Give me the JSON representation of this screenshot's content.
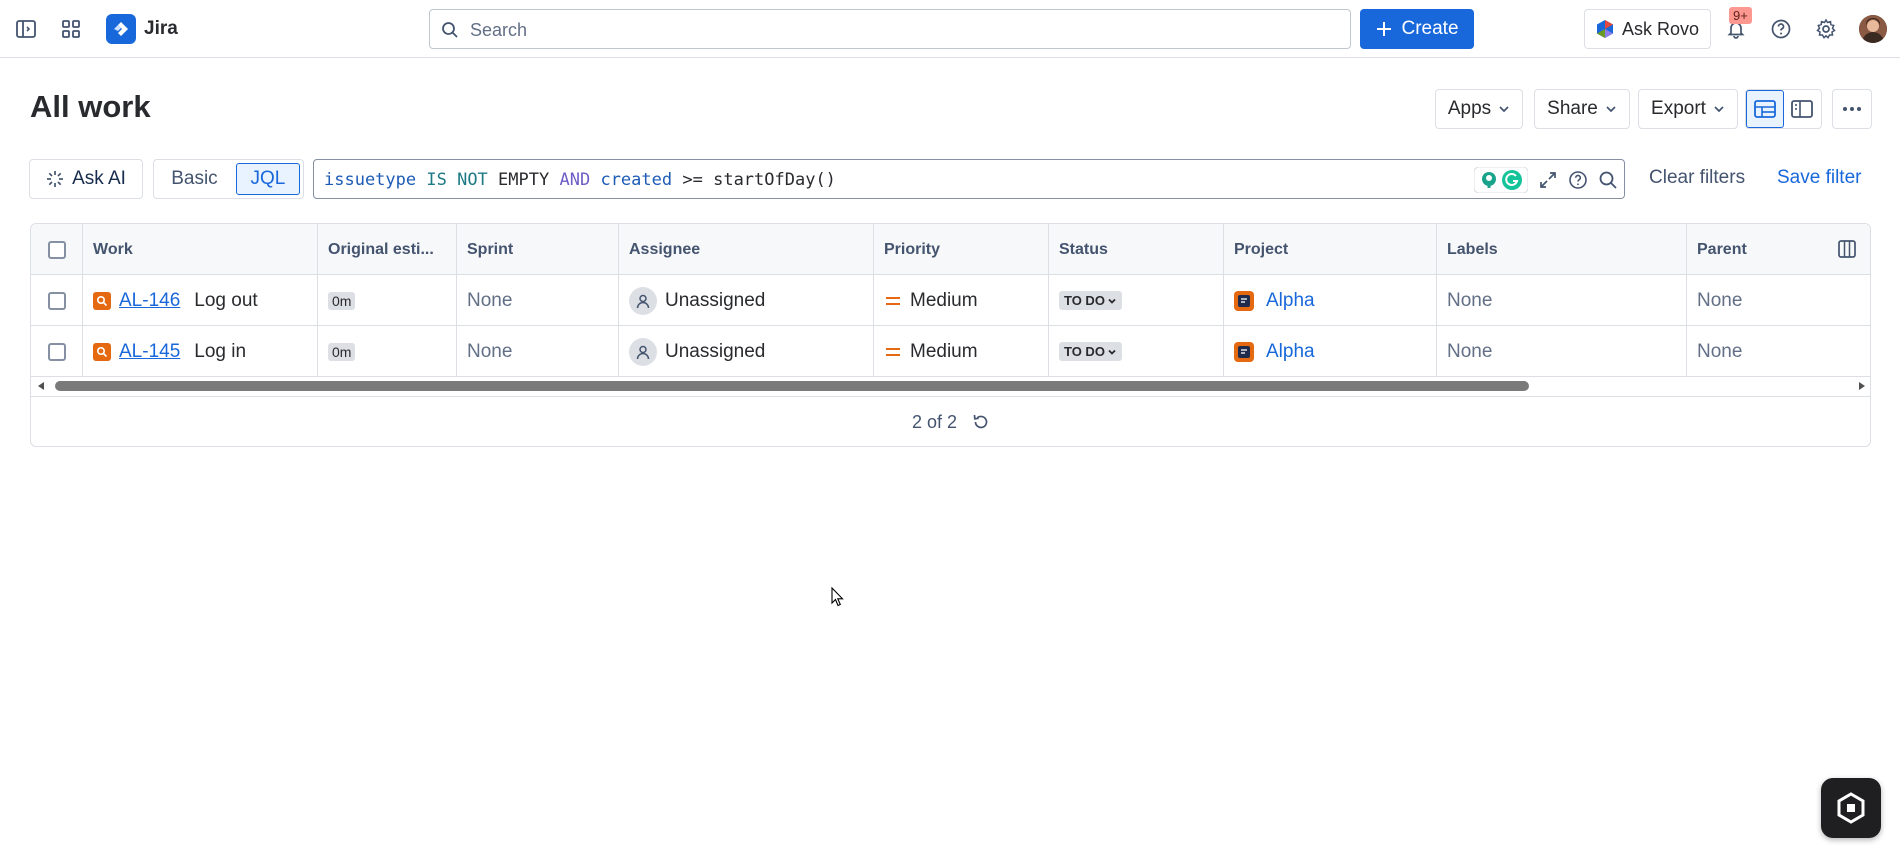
{
  "nav": {
    "app_name": "Jira",
    "search_placeholder": "Search",
    "create_label": "Create",
    "rovo_label": "Ask Rovo",
    "notif_count": "9+",
    "brand_color": "#1868db"
  },
  "page": {
    "title": "All work",
    "apps_label": "Apps",
    "share_label": "Share",
    "export_label": "Export"
  },
  "query": {
    "ask_ai_label": "Ask AI",
    "basic_label": "Basic",
    "jql_label": "JQL",
    "jql_tokens": {
      "t1": "issuetype",
      "t2": "IS NOT",
      "t3": "EMPTY",
      "t4": "AND",
      "t5": "created",
      "t6": ">=",
      "t7": "startOfDay()"
    },
    "clear_label": "Clear filters",
    "save_label": "Save filter"
  },
  "table": {
    "columns": {
      "work": "Work",
      "estimate": "Original esti...",
      "sprint": "Sprint",
      "assignee": "Assignee",
      "priority": "Priority",
      "status": "Status",
      "project": "Project",
      "labels": "Labels",
      "parent": "Parent"
    },
    "rows": [
      {
        "key": "AL-146",
        "summary": "Log out",
        "estimate": "0m",
        "sprint": "None",
        "assignee": "Unassigned",
        "priority": "Medium",
        "status": "TO DO",
        "project": "Alpha",
        "labels": "None",
        "parent": "None"
      },
      {
        "key": "AL-145",
        "summary": "Log in",
        "estimate": "0m",
        "sprint": "None",
        "assignee": "Unassigned",
        "priority": "Medium",
        "status": "TO DO",
        "project": "Alpha",
        "labels": "None",
        "parent": "None"
      }
    ],
    "pagination": "2 of 2"
  }
}
